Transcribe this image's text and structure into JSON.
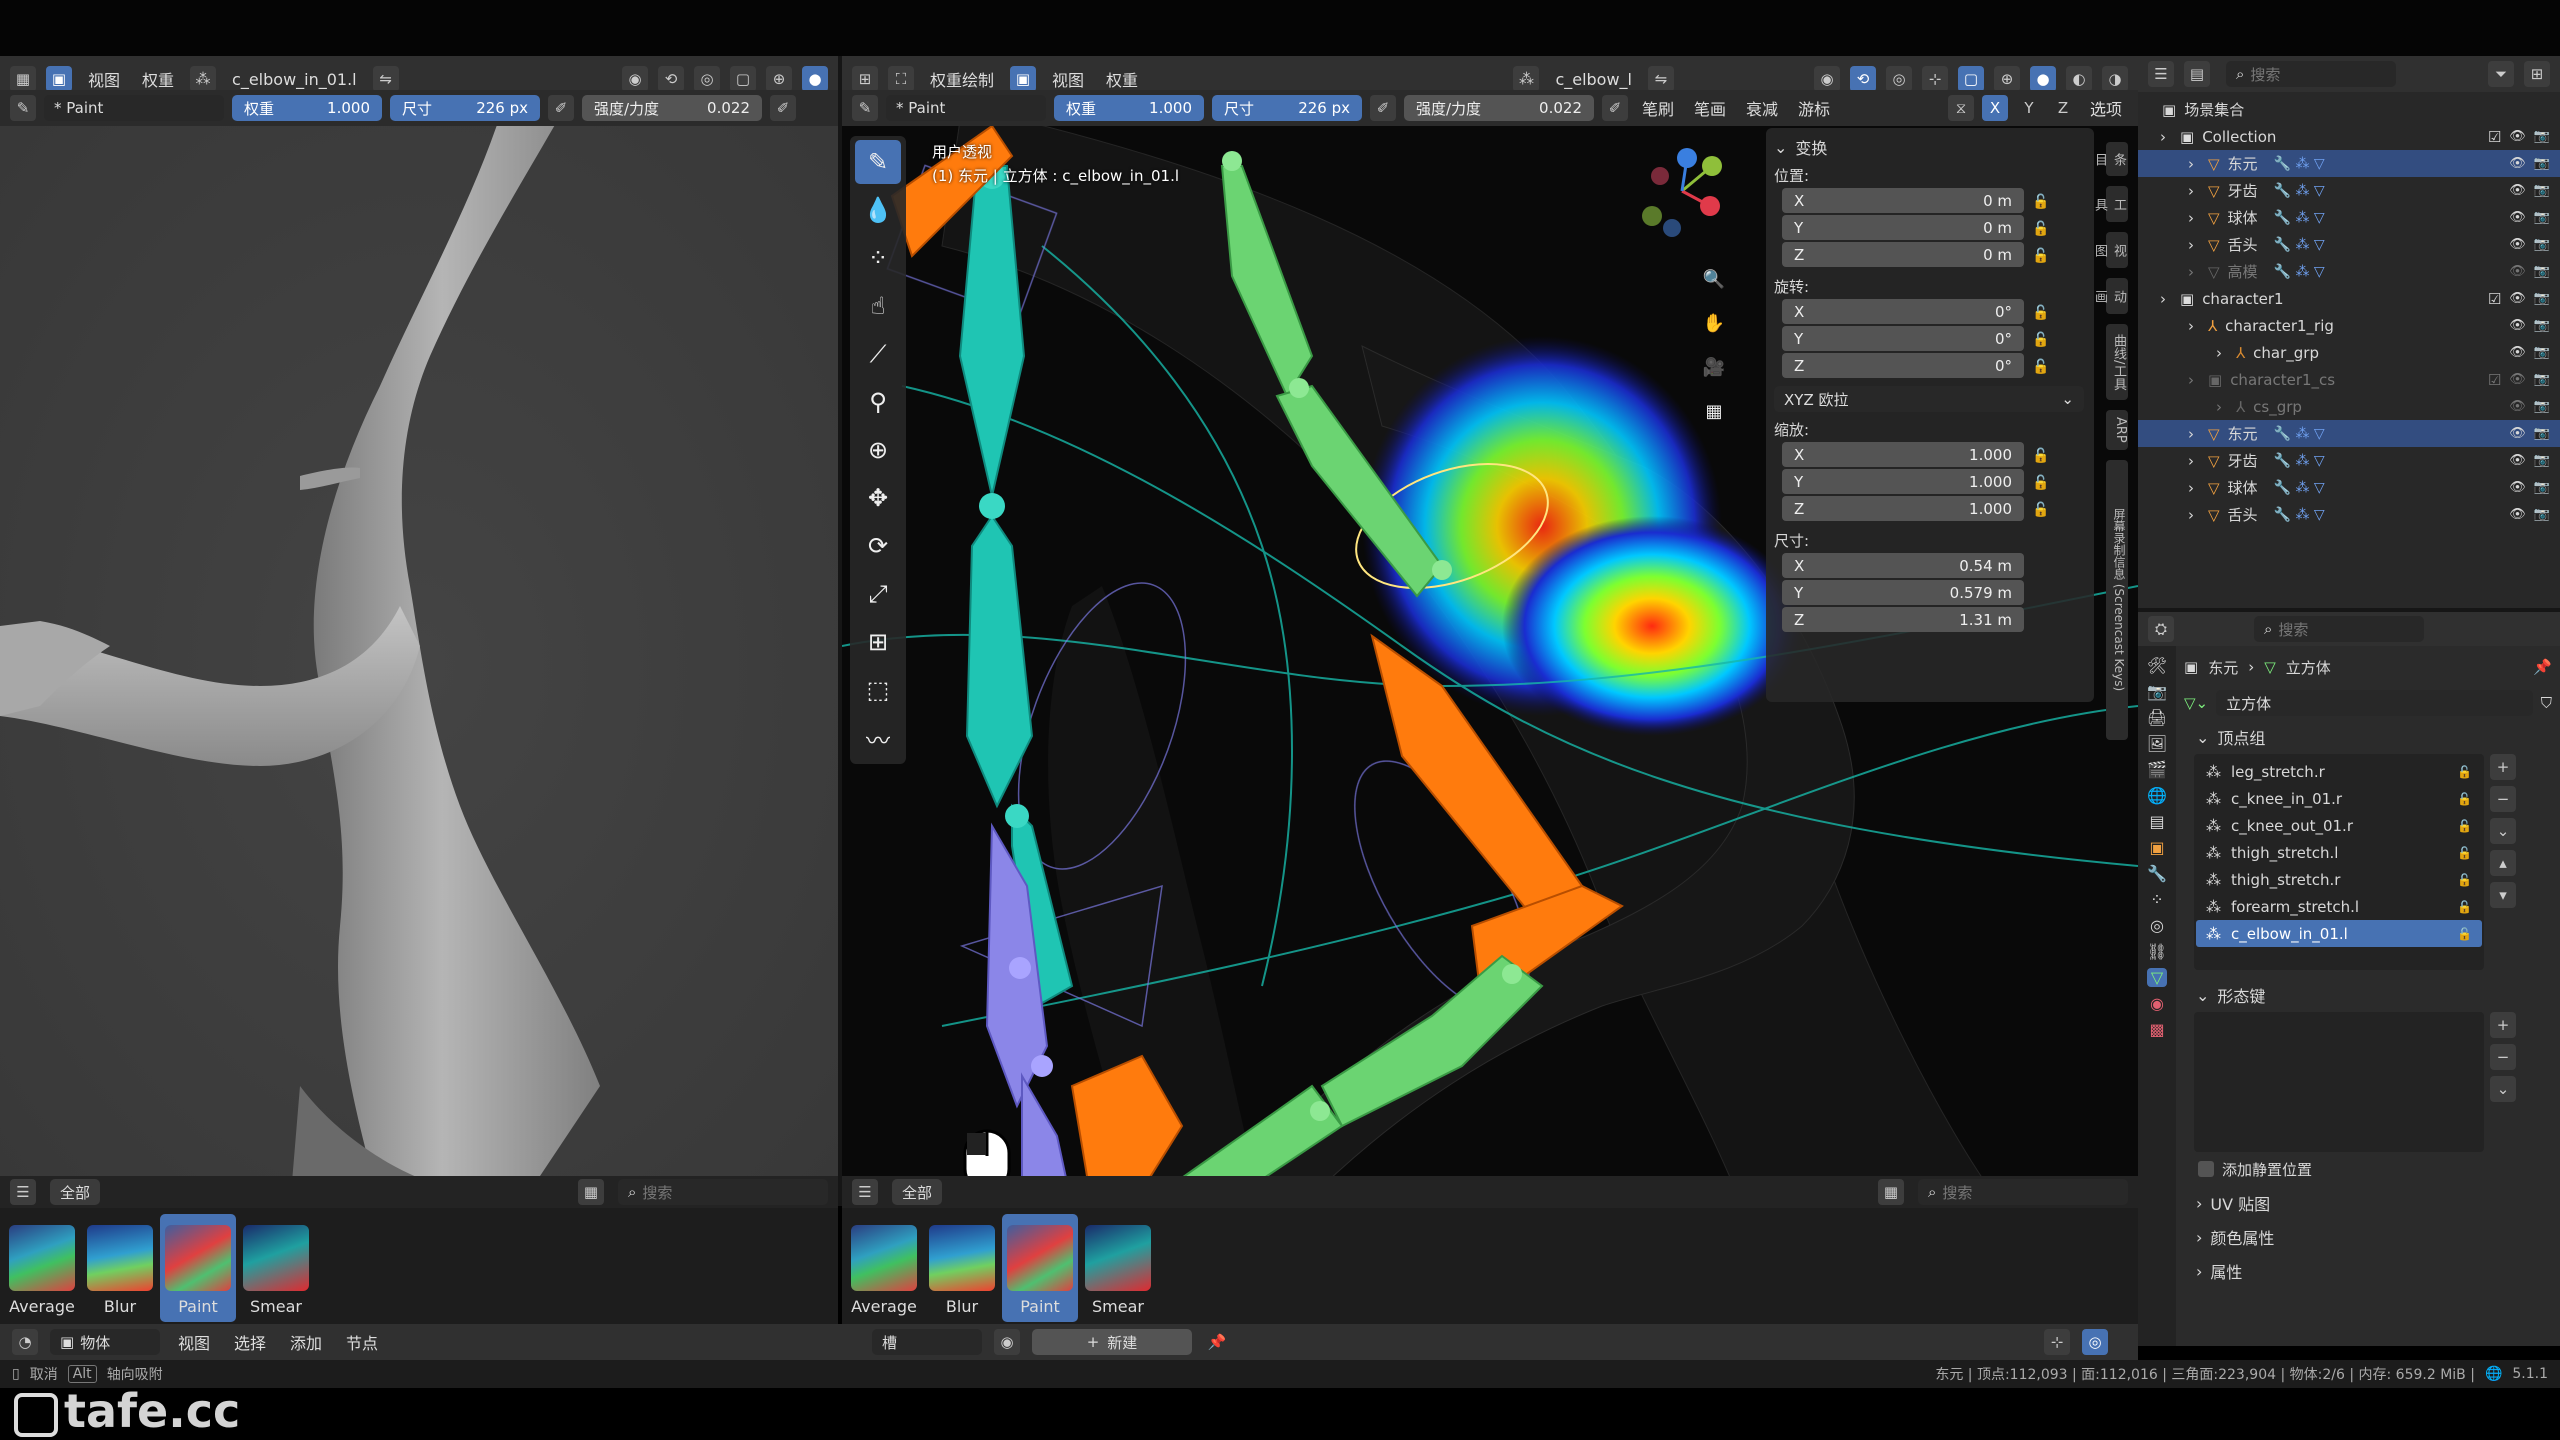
{
  "left_view": {
    "header_menus": [
      "视图",
      "权重"
    ],
    "vertex_group": "c_elbow_in_01.l",
    "tool": {
      "brush": "* Paint",
      "weight_label": "权重",
      "weight_value": "1.000",
      "size_label": "尺寸",
      "size_value": "226 px",
      "strength_label": "强度/力度",
      "strength_value": "0.022"
    },
    "shelf_tab": "全部",
    "search_placeholder": "搜索",
    "brushes": [
      "Average",
      "Blur",
      "Paint",
      "Smear"
    ],
    "selected_brush": "Paint"
  },
  "center_view": {
    "header": {
      "mode": "权重绘制",
      "menus": [
        "视图",
        "权重"
      ],
      "vertex_group": "c_elbow_l"
    },
    "tool": {
      "brush": "* Paint",
      "weight_label": "权重",
      "weight_value": "1.000",
      "size_label": "尺寸",
      "size_value": "226 px",
      "strength_label": "强度/力度",
      "strength_value": "0.022",
      "menus": [
        "笔刷",
        "笔画",
        "衰减",
        "游标"
      ],
      "options": "选项",
      "axes": [
        "X",
        "Y",
        "Z"
      ]
    },
    "overlay": {
      "line1": "用户透视",
      "line2": "(1) 东元 | 立方体 : c_elbow_in_01.l"
    },
    "shelf_tab": "全部",
    "search_placeholder": "搜索",
    "brushes": [
      "Average",
      "Blur",
      "Paint",
      "Smear"
    ],
    "selected_brush": "Paint"
  },
  "n_panel": {
    "section": "变换",
    "location": {
      "label": "位置:",
      "x": "0 m",
      "y": "0 m",
      "z": "0 m"
    },
    "rotation": {
      "label": "旋转:",
      "x": "0°",
      "y": "0°",
      "z": "0°"
    },
    "rotation_mode": "XYZ 欧拉",
    "scale": {
      "label": "缩放:",
      "x": "1.000",
      "y": "1.000",
      "z": "1.000"
    },
    "dimensions": {
      "label": "尺寸:",
      "x": "0.54 m",
      "y": "0.579 m",
      "z": "1.31 m"
    },
    "axis_labels": [
      "X",
      "Y",
      "Z"
    ],
    "tabs": [
      "条目",
      "工具",
      "视图",
      "动画",
      "曲线/工具",
      "ARP",
      "屏幕录制信息 (Screencast Keys)"
    ]
  },
  "outliner": {
    "search_placeholder": "搜索",
    "root": "场景集合",
    "items": [
      {
        "name": "Collection",
        "depth": 0,
        "type": "collection"
      },
      {
        "name": "东元",
        "depth": 1,
        "type": "mesh",
        "selected": true
      },
      {
        "name": "牙齿",
        "depth": 1,
        "type": "mesh"
      },
      {
        "name": "球体",
        "depth": 1,
        "type": "mesh"
      },
      {
        "name": "舌头",
        "depth": 1,
        "type": "mesh"
      },
      {
        "name": "高模",
        "depth": 1,
        "type": "mesh",
        "dim": true
      },
      {
        "name": "character1",
        "depth": 0,
        "type": "collection"
      },
      {
        "name": "character1_rig",
        "depth": 1,
        "type": "armature"
      },
      {
        "name": "char_grp",
        "depth": 2,
        "type": "bone"
      },
      {
        "name": "character1_cs",
        "depth": 1,
        "type": "collection",
        "dim": true
      },
      {
        "name": "cs_grp",
        "depth": 2,
        "type": "bone",
        "dim": true
      },
      {
        "name": "东元",
        "depth": 1,
        "type": "mesh",
        "selected": true
      },
      {
        "name": "牙齿",
        "depth": 1,
        "type": "mesh"
      },
      {
        "name": "球体",
        "depth": 1,
        "type": "mesh"
      },
      {
        "name": "舌头",
        "depth": 1,
        "type": "mesh"
      }
    ]
  },
  "properties": {
    "search_placeholder": "搜索",
    "breadcrumb": [
      "东元",
      "立方体"
    ],
    "mesh_name": "立方体",
    "vertex_groups_title": "顶点组",
    "vertex_groups": [
      "leg_stretch.r",
      "c_knee_in_01.r",
      "c_knee_out_01.r",
      "thigh_stretch.l",
      "thigh_stretch.r",
      "forearm_stretch.l",
      "c_elbow_in_01.l"
    ],
    "selected_vertex_group": "c_elbow_in_01.l",
    "shape_keys_title": "形态键",
    "add_rest_position": "添加静置位置",
    "uv_maps": "UV 贴图",
    "color_attributes": "颜色属性",
    "attributes": "属性"
  },
  "bottom_bar": {
    "left_menus": [
      "物体",
      "视图",
      "选择",
      "添加",
      "节点"
    ],
    "slot": "槽",
    "new_button": "新建",
    "hint_cancel": "取消",
    "hint_alt_key": "Alt",
    "hint_alt": "轴向吸附"
  },
  "status": {
    "text": "东元 | 顶点:112,093 | 面:112,016 | 三角面:223,904 | 物体:2/6 | 内存: 659.2 MiB |",
    "version": "5.1.1"
  },
  "watermark": "tafe.cc"
}
